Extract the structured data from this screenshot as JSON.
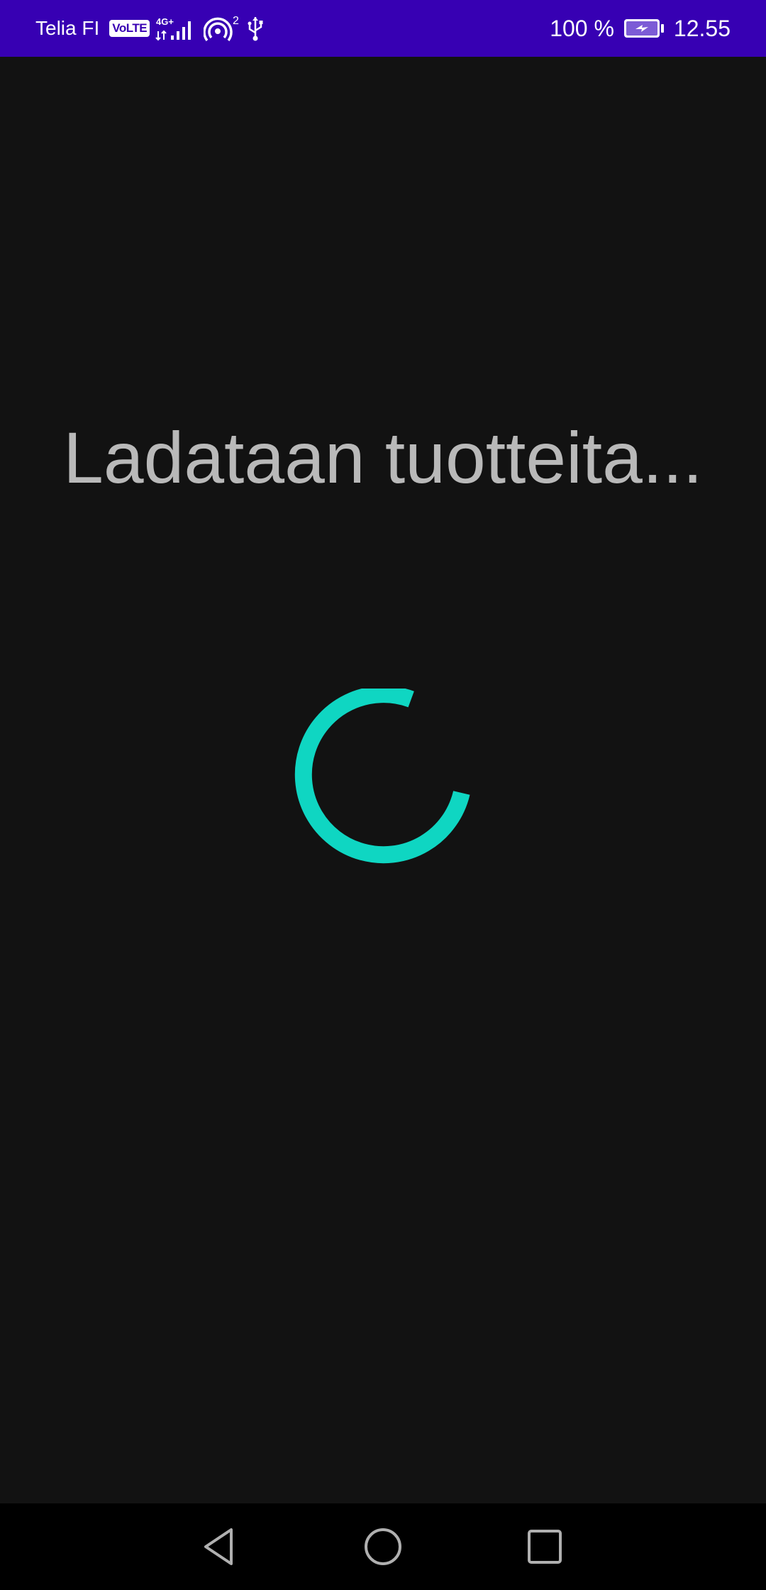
{
  "status_bar": {
    "carrier": "Telia FI",
    "volte": "VoLTE",
    "network_type": "4G+",
    "hotspot_count": "2",
    "battery_percent": "100 %",
    "time": "12.55",
    "background_color": "#3700b3",
    "icons": [
      "volte-icon",
      "signal-icon",
      "hotspot-icon",
      "usb-icon",
      "battery-charging-icon"
    ]
  },
  "main": {
    "loading_text": "Ladataan tuotteita...",
    "spinner_color": "#0fd6c2",
    "background_color": "#121212"
  },
  "nav_bar": {
    "buttons": [
      "back-icon",
      "home-icon",
      "recents-icon"
    ]
  }
}
